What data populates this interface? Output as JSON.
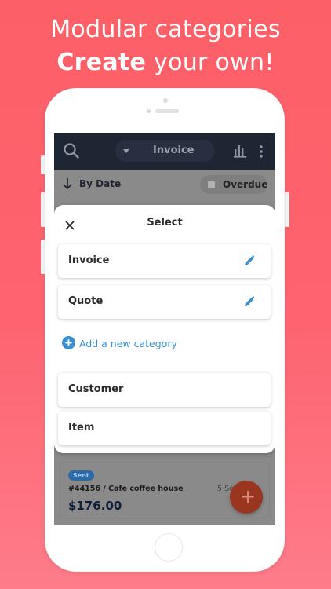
{
  "promo": {
    "line1": "Modular categories",
    "line2_bold": "Create",
    "line2_rest": " your own!"
  },
  "app": {
    "topbar": {
      "search_icon": "search-icon",
      "selected_category": "Invoice",
      "chart_icon": "bar-chart-icon",
      "more_icon": "more-vertical-icon"
    },
    "filter": {
      "sort_label": "By Date",
      "overdue_label": "Overdue"
    },
    "sheet": {
      "title": "Select",
      "categories": [
        {
          "label": "Invoice",
          "editable": true
        },
        {
          "label": "Quote",
          "editable": true
        }
      ],
      "add_label": "Add a new category",
      "other": [
        {
          "label": "Customer"
        },
        {
          "label": "Item"
        }
      ]
    },
    "invoice_card": {
      "status": "Sent",
      "reference": "#44156 / Cafe coffee house",
      "amount": "$176.00",
      "date": "5 Se"
    },
    "fab_label": "+"
  },
  "colors": {
    "background": "#fd6470",
    "topbar": "#1e2533",
    "accent_blue": "#3a8fcf",
    "fab": "#9a3520"
  }
}
